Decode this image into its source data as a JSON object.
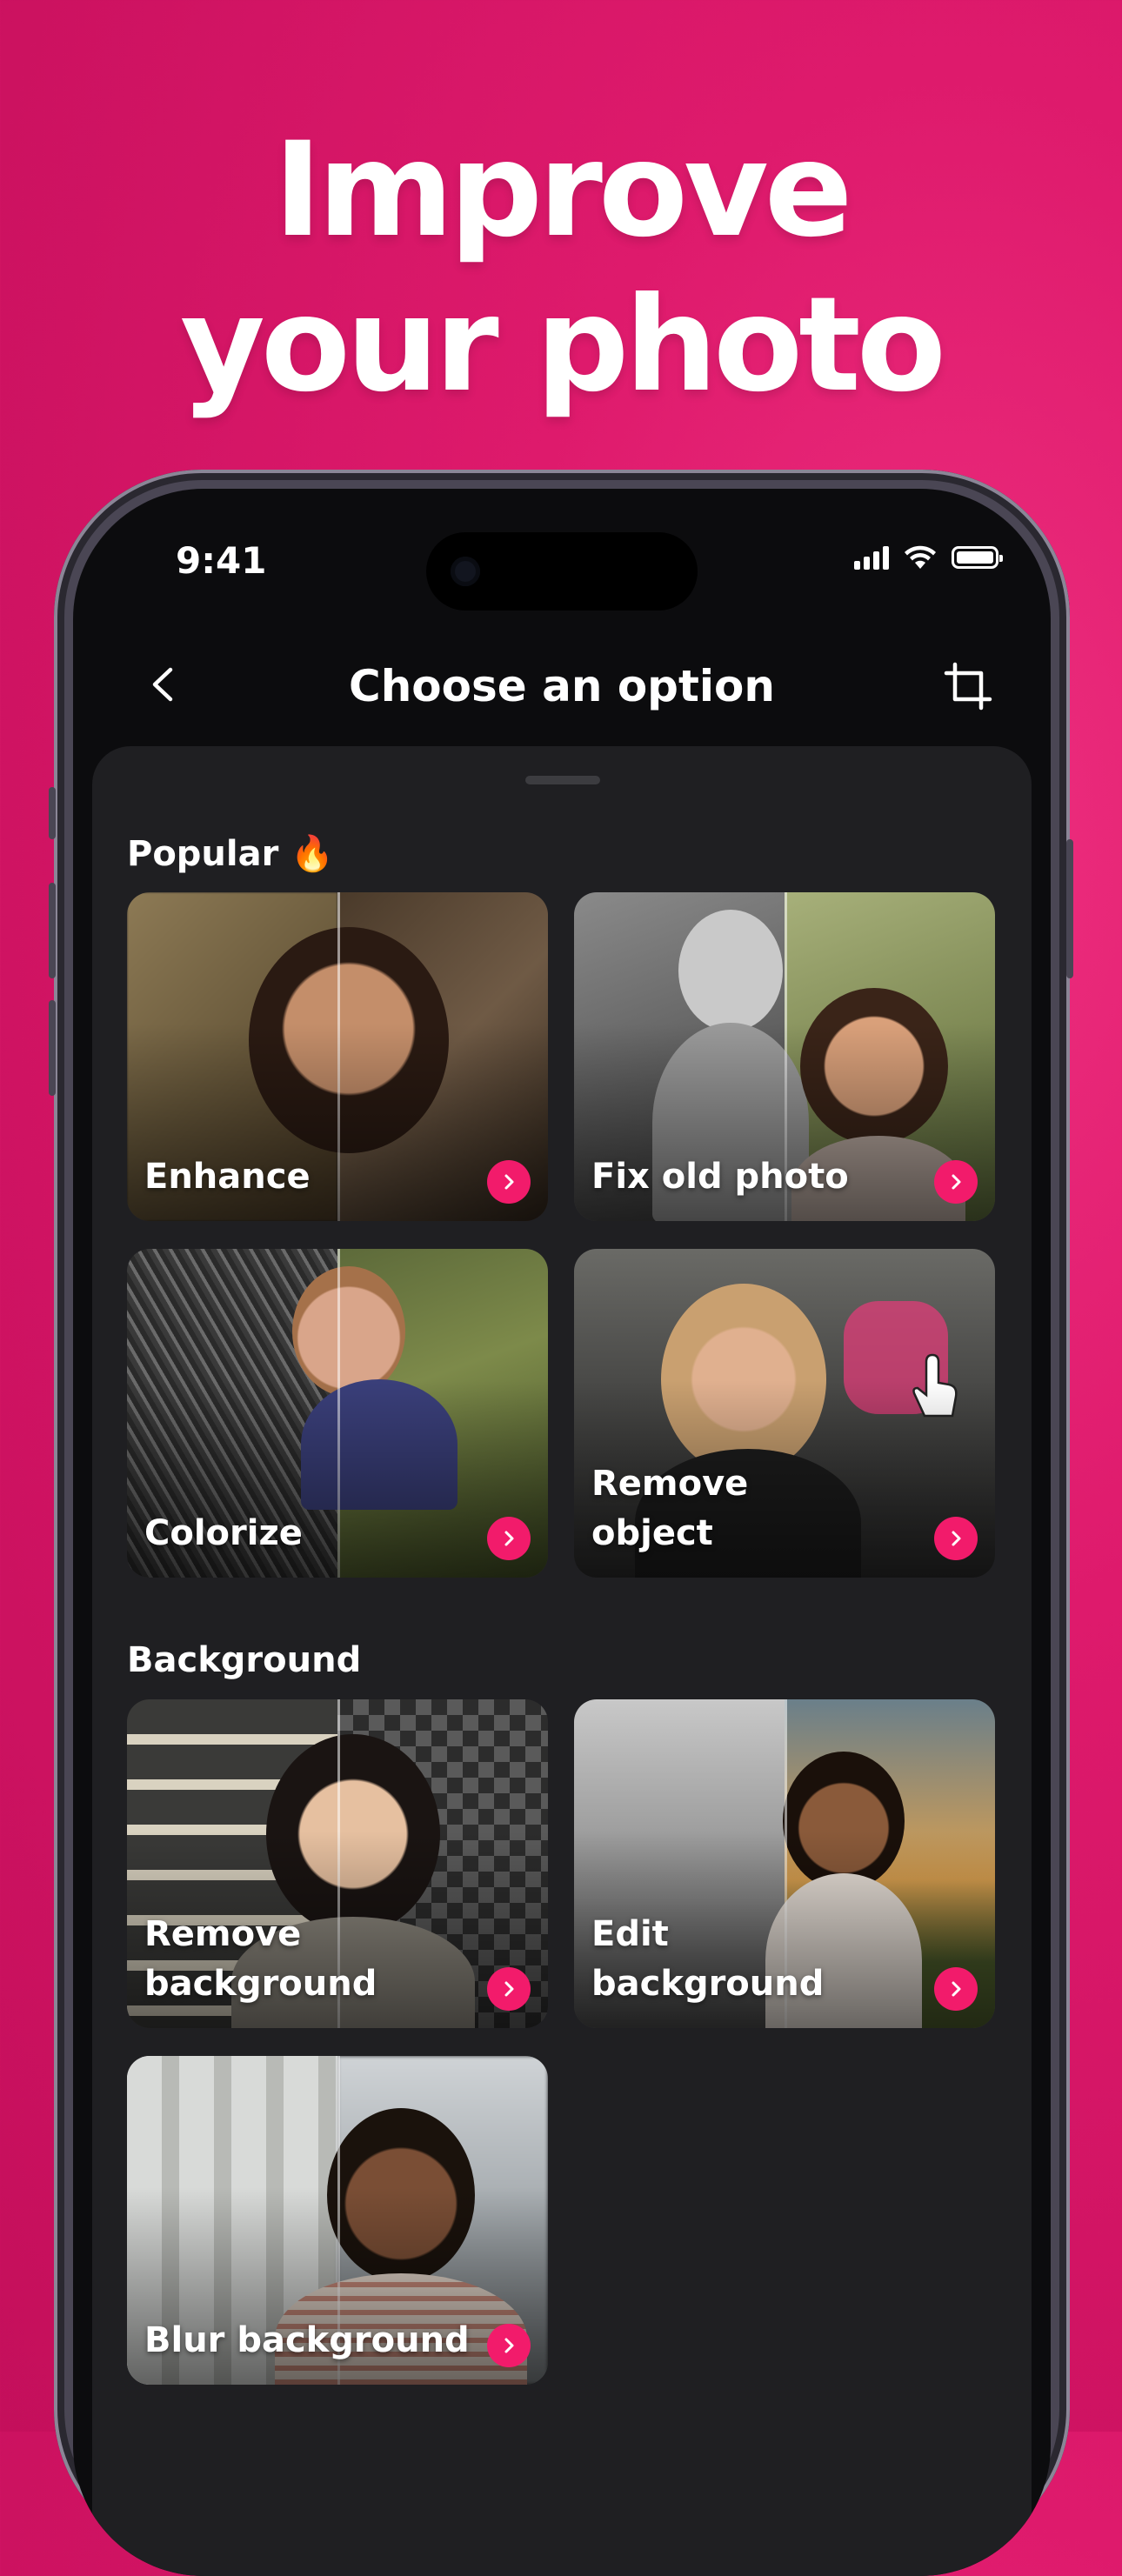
{
  "headline": {
    "line1": "Improve",
    "line2": "your photo"
  },
  "status_bar": {
    "time": "9:41"
  },
  "nav": {
    "title": "Choose an option"
  },
  "sections": {
    "popular": "Popular 🔥",
    "background": "Background"
  },
  "cards": {
    "enhance": "Enhance",
    "fix_old_photo": "Fix old photo",
    "colorize": "Colorize",
    "remove_object": "Remove\nobject",
    "remove_background": "Remove\nbackground",
    "edit_background": "Edit\nbackground",
    "blur_background": "Blur background"
  },
  "colors": {
    "accent": "#f21b6b",
    "background": "#d81467",
    "sheet": "#1f1f22"
  },
  "icons": {
    "back": "chevron-left-icon",
    "crop": "crop-icon",
    "card_arrow": "chevron-right-icon"
  }
}
